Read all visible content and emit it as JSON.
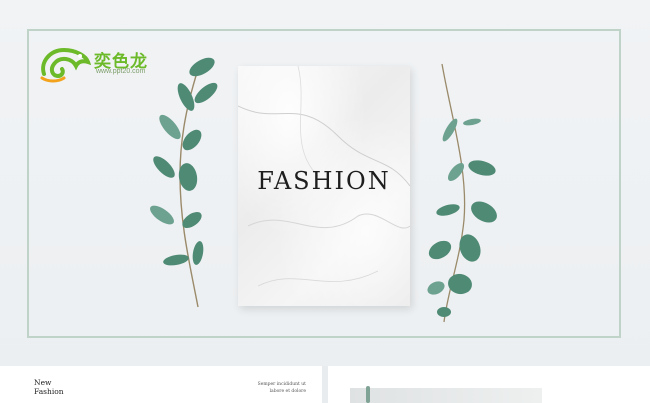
{
  "logo": {
    "name": "奕色龙",
    "url": "www.ppt20.com",
    "color": "#6cba2a"
  },
  "cover": {
    "title": "FASHION"
  },
  "colors": {
    "frame": "#bfd3c9",
    "leaf": "#4f8a75",
    "leaf_light": "#6da190",
    "stem": "#9a8a6a"
  },
  "thumbnails": {
    "left": {
      "heading_line1": "New",
      "heading_line2": "Fashion",
      "note_line1": "Semper incididunt ut",
      "note_line2": "labore et dolore"
    }
  }
}
